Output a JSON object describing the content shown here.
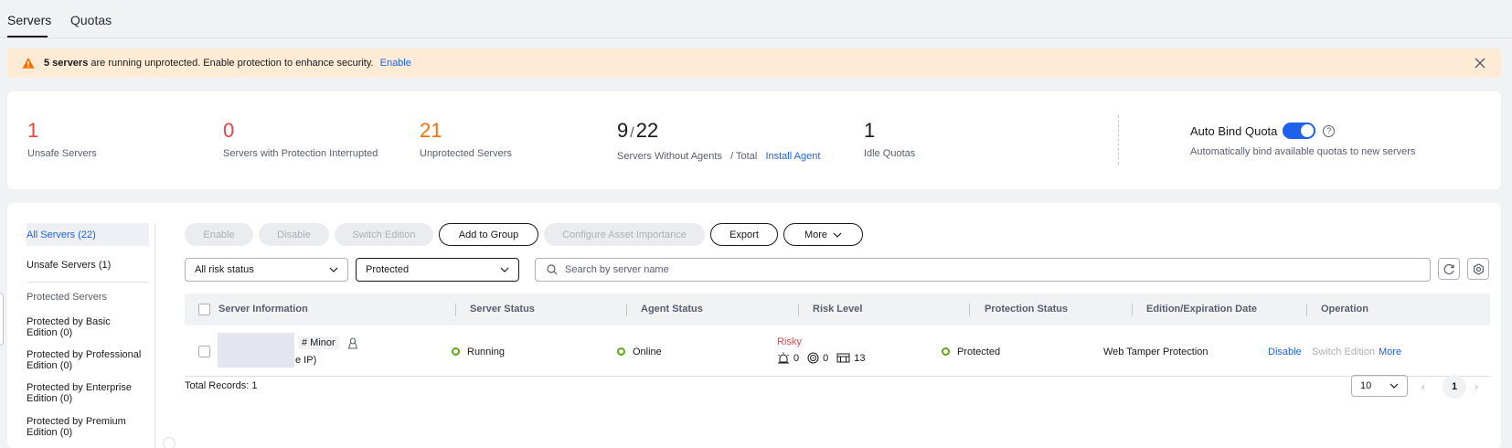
{
  "tabs": [
    {
      "label": "Servers"
    },
    {
      "label": "Quotas"
    }
  ],
  "alert": {
    "count_text": "5 servers",
    "message": " are running unprotected. Enable protection to enhance security.",
    "link": "Enable"
  },
  "stats": {
    "unsafe": {
      "value": "1",
      "label": "Unsafe Servers"
    },
    "interrupted": {
      "value": "0",
      "label": "Servers with Protection Interrupted"
    },
    "unprotected": {
      "value": "21",
      "label": "Unprotected Servers"
    },
    "agents": {
      "value_a": "9",
      "slash": "/",
      "value_b": "22",
      "label": "Servers Without Agents",
      "label_total": "/ Total",
      "link": "Install Agent"
    },
    "idle": {
      "value": "1",
      "label": "Idle Quotas"
    },
    "autobind": {
      "title": "Auto Bind Quota",
      "enabled": true,
      "desc": "Automatically bind available quotas to new servers"
    }
  },
  "sidebar": {
    "items": [
      {
        "label": "All Servers (22)"
      },
      {
        "label": "Unsafe Servers (1)"
      }
    ],
    "group_title": "Protected Servers",
    "groups": [
      {
        "line1": "Protected by Basic",
        "line2": "Edition (0)"
      },
      {
        "line1": "Protected by Professional",
        "line2": "Edition (0)"
      },
      {
        "line1": "Protected by Enterprise",
        "line2": "Edition (0)"
      },
      {
        "line1": "Protected by Premium",
        "line2": "Edition (0)"
      }
    ]
  },
  "toolbar": {
    "enable": "Enable",
    "disable": "Disable",
    "switch": "Switch Edition",
    "add_group": "Add to Group",
    "configure": "Configure Asset Importance",
    "export": "Export",
    "more": "More"
  },
  "filters": {
    "risk": "All risk status",
    "protection": "Protected",
    "search_placeholder": "Search by server name"
  },
  "table": {
    "headers": [
      "Server Information",
      "Server Status",
      "Agent Status",
      "Risk Level",
      "Protection Status",
      "Edition/Expiration Date",
      "Operation"
    ],
    "rows": [
      {
        "tag": "# Minor",
        "ip_suffix": "e IP)",
        "server_status": "Running",
        "agent_status": "Online",
        "risk": "Risky",
        "risk_a": "0",
        "risk_b": "0",
        "risk_c": "13",
        "protection": "Protected",
        "edition": "Web Tamper Protection",
        "op_disable": "Disable",
        "op_switch": "Switch Edition",
        "op_more": "More"
      }
    ]
  },
  "footer": {
    "total": "Total Records: 1",
    "page_size": "10",
    "current_page": "1"
  },
  "colors": {
    "primary": "#1e62ec",
    "danger": "#e54545",
    "warning": "#f66f00",
    "success": "#5fa713"
  }
}
